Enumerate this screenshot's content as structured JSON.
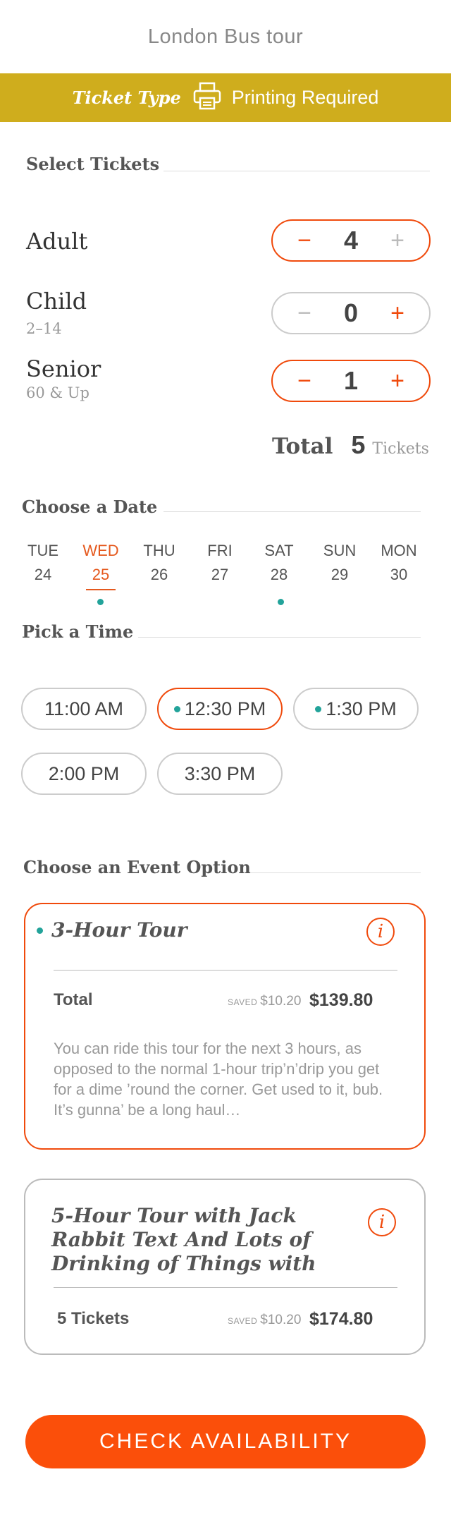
{
  "header": {
    "title": "London Bus tour"
  },
  "ticket_bar": {
    "type_label": "Ticket Type",
    "icon": "printer-icon",
    "value": "Printing Required"
  },
  "tickets": {
    "title": "Select Tickets",
    "rows": [
      {
        "label": "Adult",
        "sub": "",
        "count": "4",
        "minus": "−",
        "plus": "+"
      },
      {
        "label": "Child",
        "sub": "2–14",
        "count": "0",
        "minus": "−",
        "plus": "+"
      },
      {
        "label": "Senior",
        "sub": "60 & Up",
        "count": "1",
        "minus": "−",
        "plus": "+"
      }
    ],
    "total_label": "Total",
    "total_value": "5",
    "total_unit": "Tickets"
  },
  "date": {
    "title": "Choose a Date",
    "days": [
      {
        "name": "TUE",
        "num": "24"
      },
      {
        "name": "WED",
        "num": "25"
      },
      {
        "name": "THU",
        "num": "26"
      },
      {
        "name": "FRI",
        "num": "27"
      },
      {
        "name": "SAT",
        "num": "28"
      },
      {
        "name": "SUN",
        "num": "29"
      },
      {
        "name": "MON",
        "num": "30"
      }
    ],
    "selected": "WED"
  },
  "time": {
    "title": "Pick a Time",
    "slots": [
      "11:00 AM",
      "12:30 PM",
      "1:30 PM",
      "2:00 PM",
      "3:30 PM"
    ],
    "selected": "12:30 PM"
  },
  "event": {
    "title": "Choose an Event Option",
    "options": [
      {
        "title": "3-Hour Tour",
        "total_label": "Total",
        "saved_word": "SAVED",
        "saved_amount": "$10.20",
        "price": "$139.80",
        "description": "You can ride this tour for the next 3 hours, as opposed to the normal 1-hour trip’n’drip you get for a dime ’round the corner. Get used to it, bub. It’s gunna’ be a long haul…",
        "info": "i"
      },
      {
        "title": "5-Hour Tour with Jack Rabbit Text And Lots of Drinking of Things with",
        "total_label": "5 Tickets",
        "saved_word": "SAVED",
        "saved_amount": "$10.20",
        "price": "$174.80",
        "info": "i"
      }
    ]
  },
  "cta": {
    "label": "CHECK AVAILABILITY"
  },
  "colors": {
    "accent": "#f04a0c",
    "gold": "#cfad1d",
    "teal": "#22a39a",
    "cta": "#fb4f0a"
  }
}
